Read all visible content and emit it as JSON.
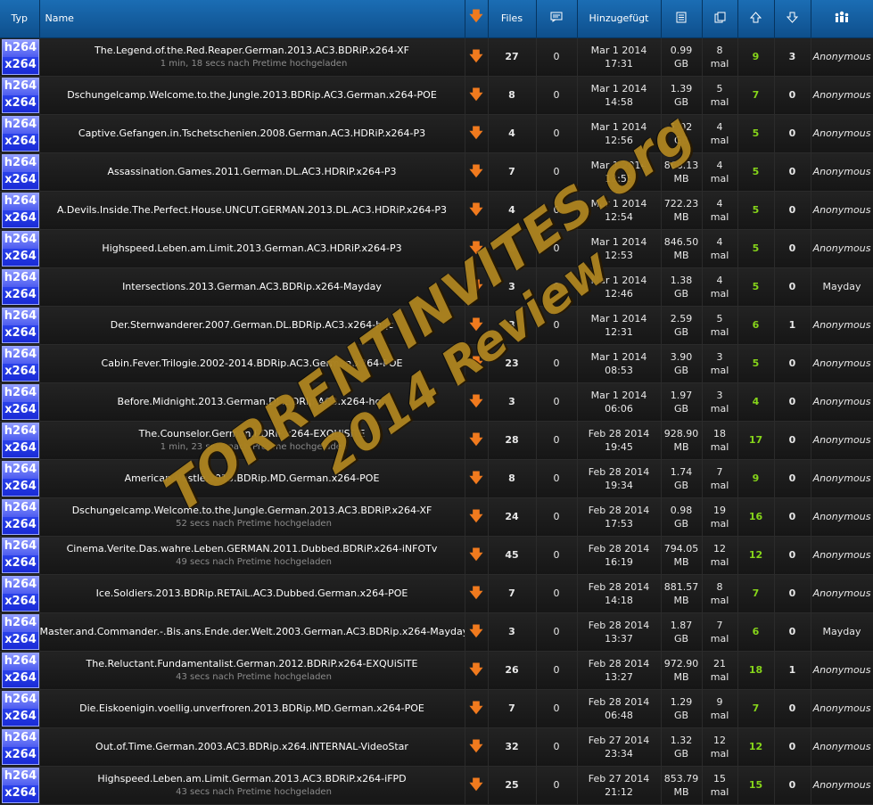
{
  "headers": {
    "typ": "Typ",
    "name": "Name",
    "files": "Files",
    "added": "Hinzugefügt"
  },
  "icons": {
    "download": "download-arrow-icon",
    "comments": "comments-icon",
    "size": "size-icon",
    "snatched": "snatched-icon",
    "seeders": "seeders-up-arrow-icon",
    "leechers": "leechers-down-arrow-icon",
    "uploader": "uploader-users-icon"
  },
  "colors": {
    "header": "#1565a8",
    "seeders": "#86d51a",
    "download_arrow": "#f07a1e",
    "type_badge": "#2a3fe8"
  },
  "type_badge": {
    "top": "h264",
    "bottom": "x264"
  },
  "watermark": {
    "line1": "TORRENTINVITES.org",
    "line2": "2014 Review"
  },
  "rows": [
    {
      "name": "The.Legend.of.the.Red.Reaper.German.2013.AC3.BDRiP.x264-XF",
      "pretime": "1 min, 18 secs nach Pretime hochgeladen",
      "files": "27",
      "comments": "0",
      "date": "Mar 1 2014",
      "time": "17:31",
      "size": "0.99",
      "unit": "GB",
      "snatched": "8",
      "snatched_unit": "mal",
      "seeders": "9",
      "leechers": "3",
      "uploader": "Anonymous"
    },
    {
      "name": "Dschungelcamp.Welcome.to.the.Jungle.2013.BDRip.AC3.German.x264-POE",
      "pretime": "",
      "files": "8",
      "comments": "0",
      "date": "Mar 1 2014",
      "time": "14:58",
      "size": "1.39",
      "unit": "GB",
      "snatched": "5",
      "snatched_unit": "mal",
      "seeders": "7",
      "leechers": "0",
      "uploader": "Anonymous"
    },
    {
      "name": "Captive.Gefangen.in.Tschetschenien.2008.German.AC3.HDRiP.x264-P3",
      "pretime": "",
      "files": "4",
      "comments": "0",
      "date": "Mar 1 2014",
      "time": "12:56",
      "size": "1.02",
      "unit": "GB",
      "snatched": "4",
      "snatched_unit": "mal",
      "seeders": "5",
      "leechers": "0",
      "uploader": "Anonymous"
    },
    {
      "name": "Assassination.Games.2011.German.DL.AC3.HDRiP.x264-P3",
      "pretime": "",
      "files": "7",
      "comments": "0",
      "date": "Mar 1 2014",
      "time": "12:55",
      "size": "868.13",
      "unit": "MB",
      "snatched": "4",
      "snatched_unit": "mal",
      "seeders": "5",
      "leechers": "0",
      "uploader": "Anonymous"
    },
    {
      "name": "A.Devils.Inside.The.Perfect.House.UNCUT.GERMAN.2013.DL.AC3.HDRiP.x264-P3",
      "pretime": "",
      "files": "4",
      "comments": "0",
      "date": "Mar 1 2014",
      "time": "12:54",
      "size": "722.23",
      "unit": "MB",
      "snatched": "4",
      "snatched_unit": "mal",
      "seeders": "5",
      "leechers": "0",
      "uploader": "Anonymous"
    },
    {
      "name": "Highspeed.Leben.am.Limit.2013.German.AC3.HDRiP.x264-P3",
      "pretime": "",
      "files": "8",
      "comments": "0",
      "date": "Mar 1 2014",
      "time": "12:53",
      "size": "846.50",
      "unit": "MB",
      "snatched": "4",
      "snatched_unit": "mal",
      "seeders": "5",
      "leechers": "0",
      "uploader": "Anonymous"
    },
    {
      "name": "Intersections.2013.German.AC3.BDRip.x264-Mayday",
      "pretime": "",
      "files": "3",
      "comments": "0",
      "date": "Mar 1 2014",
      "time": "12:46",
      "size": "1.38",
      "unit": "GB",
      "snatched": "4",
      "snatched_unit": "mal",
      "seeders": "5",
      "leechers": "0",
      "uploader": "Mayday"
    },
    {
      "name": "Der.Sternwanderer.2007.German.DL.BDRip.AC3.x264-hqc",
      "pretime": "",
      "files": "3",
      "comments": "0",
      "date": "Mar 1 2014",
      "time": "12:31",
      "size": "2.59",
      "unit": "GB",
      "snatched": "5",
      "snatched_unit": "mal",
      "seeders": "6",
      "leechers": "1",
      "uploader": "Anonymous"
    },
    {
      "name": "Cabin.Fever.Trilogie.2002-2014.BDRip.AC3.German.x264-POE",
      "pretime": "",
      "files": "23",
      "comments": "0",
      "date": "Mar 1 2014",
      "time": "08:53",
      "size": "3.90",
      "unit": "GB",
      "snatched": "3",
      "snatched_unit": "mal",
      "seeders": "5",
      "leechers": "0",
      "uploader": "Anonymous"
    },
    {
      "name": "Before.Midnight.2013.German.DL.BDRip.AC3.x264-hqc",
      "pretime": "",
      "files": "3",
      "comments": "0",
      "date": "Mar 1 2014",
      "time": "06:06",
      "size": "1.97",
      "unit": "GB",
      "snatched": "3",
      "snatched_unit": "mal",
      "seeders": "4",
      "leechers": "0",
      "uploader": "Anonymous"
    },
    {
      "name": "The.Counselor.German.BDRiP.x264-EXQUiSiTE",
      "pretime": "1 min, 23 secs nach Pretime hochgeladen",
      "files": "28",
      "comments": "0",
      "date": "Feb 28 2014",
      "time": "19:45",
      "size": "928.90",
      "unit": "MB",
      "snatched": "18",
      "snatched_unit": "mal",
      "seeders": "17",
      "leechers": "0",
      "uploader": "Anonymous"
    },
    {
      "name": "American.Hustle.2013.BDRip.MD.German.x264-POE",
      "pretime": "",
      "files": "8",
      "comments": "0",
      "date": "Feb 28 2014",
      "time": "19:34",
      "size": "1.74",
      "unit": "GB",
      "snatched": "7",
      "snatched_unit": "mal",
      "seeders": "9",
      "leechers": "0",
      "uploader": "Anonymous"
    },
    {
      "name": "Dschungelcamp.Welcome.to.the.Jungle.German.2013.AC3.BDRiP.x264-XF",
      "pretime": "52 secs nach Pretime hochgeladen",
      "files": "24",
      "comments": "0",
      "date": "Feb 28 2014",
      "time": "17:53",
      "size": "0.98",
      "unit": "GB",
      "snatched": "19",
      "snatched_unit": "mal",
      "seeders": "16",
      "leechers": "0",
      "uploader": "Anonymous"
    },
    {
      "name": "Cinema.Verite.Das.wahre.Leben.GERMAN.2011.Dubbed.BDRiP.x264-iNFOTv",
      "pretime": "49 secs nach Pretime hochgeladen",
      "files": "45",
      "comments": "0",
      "date": "Feb 28 2014",
      "time": "16:19",
      "size": "794.05",
      "unit": "MB",
      "snatched": "12",
      "snatched_unit": "mal",
      "seeders": "12",
      "leechers": "0",
      "uploader": "Anonymous"
    },
    {
      "name": "Ice.Soldiers.2013.BDRip.RETAiL.AC3.Dubbed.German.x264-POE",
      "pretime": "",
      "files": "7",
      "comments": "0",
      "date": "Feb 28 2014",
      "time": "14:18",
      "size": "881.57",
      "unit": "MB",
      "snatched": "8",
      "snatched_unit": "mal",
      "seeders": "7",
      "leechers": "0",
      "uploader": "Anonymous"
    },
    {
      "name": "Master.and.Commander.-.Bis.ans.Ende.der.Welt.2003.German.AC3.BDRip.x264-Mayday",
      "pretime": "",
      "files": "3",
      "comments": "0",
      "date": "Feb 28 2014",
      "time": "13:37",
      "size": "1.87",
      "unit": "GB",
      "snatched": "7",
      "snatched_unit": "mal",
      "seeders": "6",
      "leechers": "0",
      "uploader": "Mayday"
    },
    {
      "name": "The.Reluctant.Fundamentalist.German.2012.BDRiP.x264-EXQUiSiTE",
      "pretime": "43 secs nach Pretime hochgeladen",
      "files": "26",
      "comments": "0",
      "date": "Feb 28 2014",
      "time": "13:27",
      "size": "972.90",
      "unit": "MB",
      "snatched": "21",
      "snatched_unit": "mal",
      "seeders": "18",
      "leechers": "1",
      "uploader": "Anonymous"
    },
    {
      "name": "Die.Eiskoenigin.voellig.unverfroren.2013.BDRip.MD.German.x264-POE",
      "pretime": "",
      "files": "7",
      "comments": "0",
      "date": "Feb 28 2014",
      "time": "06:48",
      "size": "1.29",
      "unit": "GB",
      "snatched": "9",
      "snatched_unit": "mal",
      "seeders": "7",
      "leechers": "0",
      "uploader": "Anonymous"
    },
    {
      "name": "Out.of.Time.German.2003.AC3.BDRip.x264.iNTERNAL-VideoStar",
      "pretime": "",
      "files": "32",
      "comments": "0",
      "date": "Feb 27 2014",
      "time": "23:34",
      "size": "1.32",
      "unit": "GB",
      "snatched": "12",
      "snatched_unit": "mal",
      "seeders": "12",
      "leechers": "0",
      "uploader": "Anonymous"
    },
    {
      "name": "Highspeed.Leben.am.Limit.German.2013.AC3.BDRiP.x264-iFPD",
      "pretime": "43 secs nach Pretime hochgeladen",
      "files": "25",
      "comments": "0",
      "date": "Feb 27 2014",
      "time": "21:12",
      "size": "853.79",
      "unit": "MB",
      "snatched": "15",
      "snatched_unit": "mal",
      "seeders": "15",
      "leechers": "0",
      "uploader": "Anonymous"
    }
  ]
}
